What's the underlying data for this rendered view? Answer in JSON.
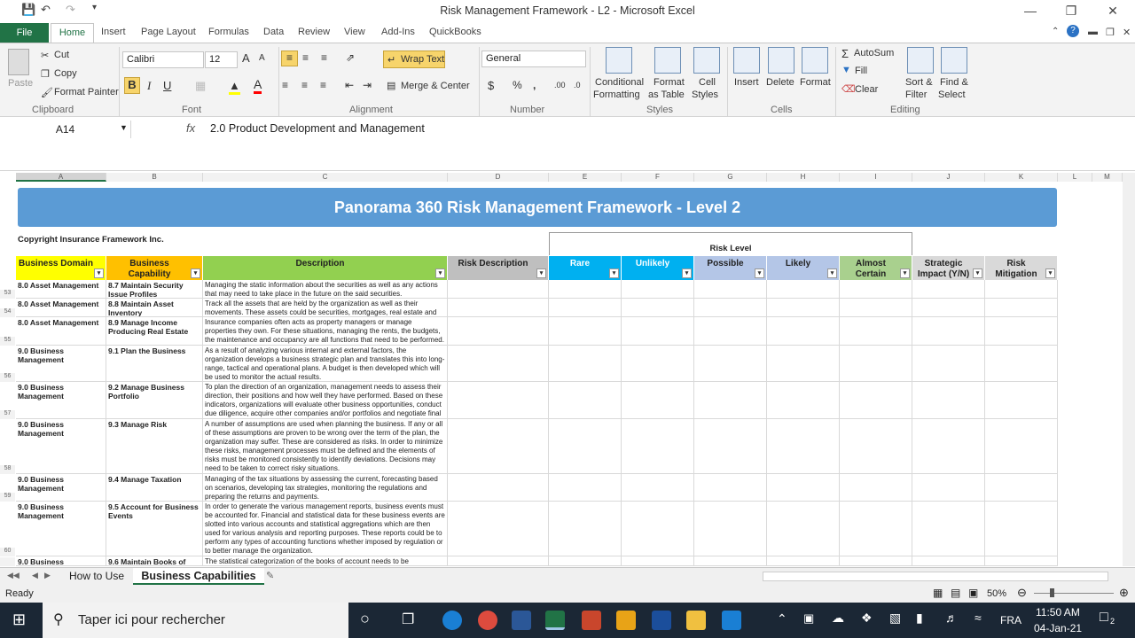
{
  "window": {
    "title": "Risk Management Framework - L2  -  Microsoft Excel"
  },
  "tabs": [
    "File",
    "Home",
    "Insert",
    "Page Layout",
    "Formulas",
    "Data",
    "Review",
    "View",
    "Add-Ins",
    "QuickBooks"
  ],
  "ribbon": {
    "clipboard": {
      "label": "Clipboard",
      "paste": "Paste",
      "cut": "Cut",
      "copy": "Copy",
      "format_painter": "Format Painter"
    },
    "font": {
      "label": "Font",
      "name": "Calibri",
      "size": "12"
    },
    "alignment": {
      "label": "Alignment",
      "wrap_text": "Wrap Text",
      "merge": "Merge & Center"
    },
    "number": {
      "label": "Number",
      "format": "General"
    },
    "styles": {
      "label": "Styles",
      "conditional": "Conditional",
      "conditional2": "Formatting",
      "table": "Format",
      "table2": "as Table",
      "cell": "Cell",
      "cell2": "Styles"
    },
    "cells": {
      "label": "Cells",
      "insert": "Insert",
      "delete": "Delete",
      "format": "Format"
    },
    "editing": {
      "label": "Editing",
      "autosum": "AutoSum",
      "fill": "Fill",
      "clear": "Clear",
      "sort": "Sort &",
      "sort2": "Filter",
      "find": "Find &",
      "find2": "Select"
    }
  },
  "formula_bar": {
    "name_box": "A14",
    "formula": "2.0 Product Development and Management"
  },
  "columns": [
    "A",
    "B",
    "C",
    "D",
    "E",
    "F",
    "G",
    "H",
    "I",
    "J",
    "K",
    "L",
    "M"
  ],
  "sheet": {
    "banner": "Panorama 360 Risk Management Framework - Level 2",
    "copyright": "Copyright Insurance Framework Inc.",
    "risk_level": "Risk Level",
    "headers": [
      "Business Domain",
      "Business Capability",
      "Description",
      "Risk Description",
      "Rare",
      "Unlikely",
      "Possible",
      "Likely",
      "Almost Certain",
      "Strategic Impact (Y/N)",
      "Risk Mitigation Approaches"
    ],
    "rows": [
      {
        "num": "53",
        "domain": "8.0 Asset Management",
        "capability": "8.7 Maintain Security Issue Profiles",
        "desc": "Managing the static information about the securities as well as any actions that may need to take place in the future on the said securities."
      },
      {
        "num": "54",
        "domain": "8.0 Asset Management",
        "capability": "8.8 Maintain Asset Inventory",
        "desc": "Track all the assets that are held by the organization as well as their movements. These assets could be securities, mortgages, real estate and"
      },
      {
        "num": "55",
        "domain": "8.0 Asset Management",
        "capability": "8.9 Manage Income Producing Real Estate",
        "desc": "Insurance companies often acts as property managers or manage properties they own. For these situations, managing the rents, the budgets, the maintenance and occupancy are all functions that need to be performed."
      },
      {
        "num": "56",
        "domain": "9.0 Business Management",
        "capability": "9.1 Plan the Business",
        "desc": "As a result of analyzing various internal and external factors, the organization develops a business strategic plan and translates this into long-range, tactical and operational plans. A budget is then developed which will be used to monitor the actual results."
      },
      {
        "num": "57",
        "domain": "9.0 Business Management",
        "capability": "9.2 Manage Business Portfolio",
        "desc": "To plan the direction of an organization, management needs to assess their direction, their positions and how well they have performed. Based on these indicators, organizations will evaluate other business opportunities, conduct due diligence, acquire other companies and/or portfolios and negotiate final"
      },
      {
        "num": "58",
        "domain": "9.0 Business Management",
        "capability": "9.3 Manage Risk",
        "desc": "A number of assumptions are used when planning the business. If any or all of these assumptions are proven to be wrong over the term of the plan, the organization may suffer. These are considered as risks. In order to minimize these risks, management processes must be defined and the elements of risks must be monitored consistently to identify deviations. Decisions may need to be taken to correct risky situations."
      },
      {
        "num": "59",
        "domain": "9.0 Business Management",
        "capability": "9.4 Manage Taxation",
        "desc": "Managing of the tax situations by assessing the current, forecasting based on scenarios, developing tax strategies, monitoring the regulations and preparing the returns and payments."
      },
      {
        "num": "60",
        "domain": "9.0 Business Management",
        "capability": "9.5 Account for Business Events",
        "desc": "In order to generate the various management reports, business events must be accounted for. Financial and statistical data for these business events are slotted into various accounts and statistical aggregations which are then used for various analysis and reporting purposes. These reports could be to perform any types of accounting functions whether imposed by regulation or to better manage the organization."
      },
      {
        "num": "",
        "domain": "9.0 Business",
        "capability": "9.6 Maintain Books of",
        "desc": "The statistical categorization of the books of account needs to be maintained in"
      }
    ]
  },
  "sheet_tabs": [
    "How to Use",
    "Business Capabilities"
  ],
  "status": {
    "ready": "Ready",
    "zoom": "50%"
  },
  "taskbar": {
    "search": "Taper ici pour rechercher",
    "lang": "FRA",
    "time": "11:50 AM",
    "date": "04-Jan-21",
    "notif": "2"
  }
}
